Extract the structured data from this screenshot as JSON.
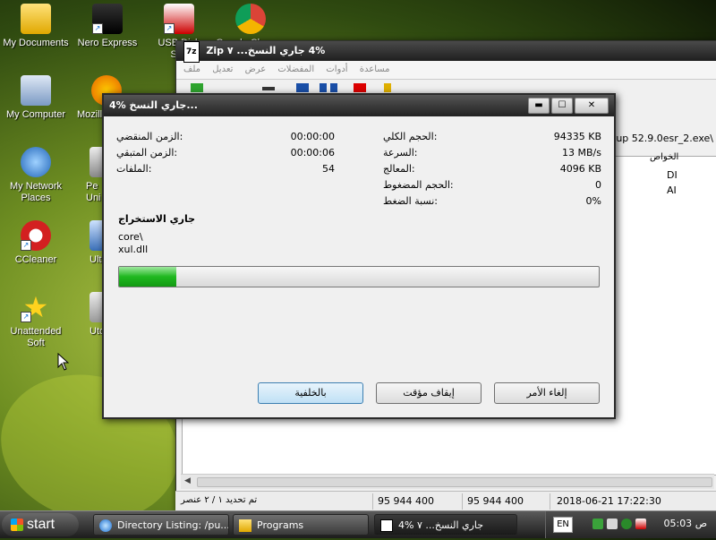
{
  "desktop": {
    "icons": [
      {
        "label": "My Documents"
      },
      {
        "label": "Nero Express"
      },
      {
        "label": "USB Disk Sec"
      },
      {
        "label": "Google Chrome"
      },
      {
        "label": "My Computer"
      },
      {
        "label": "Mozill"
      },
      {
        "label": "My Network Places"
      },
      {
        "label": "Pe Uni"
      },
      {
        "label": "CCleaner"
      },
      {
        "label": "Ulti"
      },
      {
        "label": "Unattended Soft"
      },
      {
        "label": "Uto"
      }
    ]
  },
  "zip_window": {
    "title": "4% جاري النسخ... ٧ Zip",
    "title_badge": "7z",
    "menu": [
      "مساعدة",
      "أدوات",
      "المفضلات",
      "عرض",
      "تعديل",
      "ملف"
    ],
    "path": "tup 52.9.0esr_2.exe\\",
    "column_header": "الخواص",
    "cells": [
      "DI",
      "AI"
    ],
    "status": {
      "selected": "تم تحديد ١ / ٢ عنصر",
      "size": "95 944 400",
      "packed": "95 944 400",
      "modified": "2018-06-21 17:22:30"
    }
  },
  "dialog": {
    "title": "4% جاري النسخ...",
    "controls": {
      "minimize": "▬",
      "maximize": "☐",
      "close": "✕"
    },
    "left_stats": [
      {
        "label": "الزمن المنقضي:",
        "value": "00:00:00"
      },
      {
        "label": "الزمن المتبقي:",
        "value": "00:00:06"
      },
      {
        "label": "الملفات:",
        "value": "54"
      }
    ],
    "right_stats": [
      {
        "label": "الحجم الكلي:",
        "value": "94335 KB"
      },
      {
        "label": "السرعة:",
        "value": "13 MB/s"
      },
      {
        "label": "المعالج:",
        "value": "4096 KB"
      },
      {
        "label": "الحجم المضغوط:",
        "value": "0"
      },
      {
        "label": "نسبة الضغط:",
        "value": "0%"
      }
    ],
    "section_label": "جاري الاستخراج",
    "current_folder": "core\\",
    "current_file": "xul.dll",
    "progress_percent": 4,
    "progress_fill_fraction": 0.12,
    "buttons": {
      "background": "بالخلفية",
      "pause": "إيقاف مؤقت",
      "cancel": "إلغاء الأمر"
    }
  },
  "taskbar": {
    "start": "start",
    "tasks": [
      {
        "label": "Directory Listing: /pu..."
      },
      {
        "label": "Programs"
      },
      {
        "label": "4% جاري النسخ... ٧"
      }
    ],
    "language": "EN",
    "clock": "05:03 ص"
  },
  "colors": {
    "progress_green": "#1fb81f",
    "taskbar_dark": "#1c1c1c",
    "wallpaper_green": "#6f8f22"
  }
}
